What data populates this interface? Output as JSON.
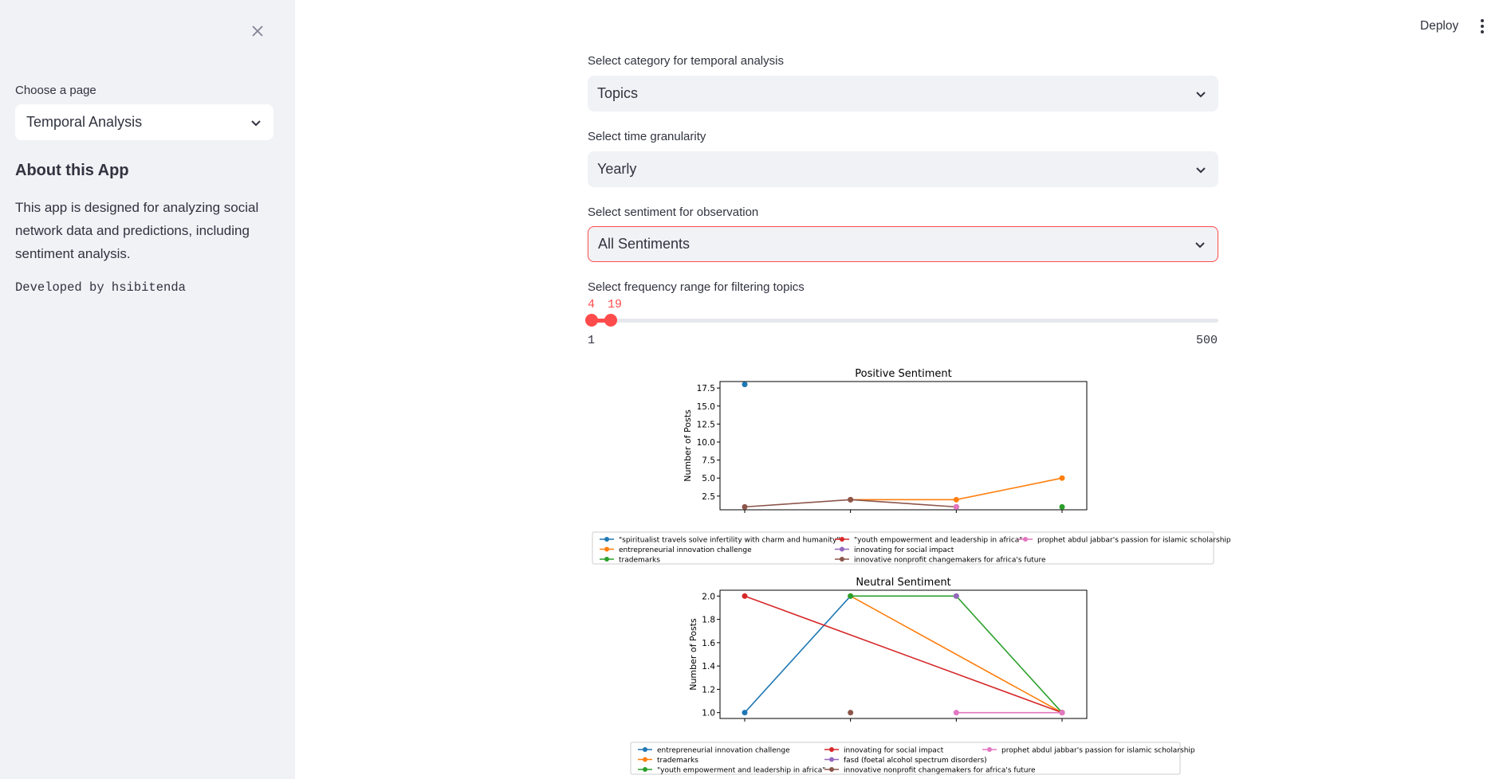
{
  "sidebar": {
    "page_select_label": "Choose a page",
    "page_select_value": "Temporal Analysis",
    "about_title": "About this App",
    "about_text": "This app is designed for analyzing social network data and predictions, including sentiment analysis.",
    "developer": "Developed by hsibitenda"
  },
  "header": {
    "deploy": "Deploy"
  },
  "controls": {
    "category": {
      "label": "Select category for temporal analysis",
      "value": "Topics"
    },
    "granularity": {
      "label": "Select time granularity",
      "value": "Yearly"
    },
    "sentiment": {
      "label": "Select sentiment for observation",
      "value": "All Sentiments"
    },
    "frequency": {
      "label": "Select frequency range for filtering topics",
      "low": 4,
      "high": 19,
      "min": 1,
      "max": 500
    }
  },
  "colors": {
    "accent": "#ff4b4b",
    "series": [
      "#1f77b4",
      "#ff7f0e",
      "#2ca02c",
      "#d62728",
      "#9467bd",
      "#8c564b",
      "#e377c2"
    ]
  },
  "chart_data": [
    {
      "type": "line",
      "title": "Positive Sentiment",
      "ylabel": "Number of Posts",
      "xlabel": "",
      "ylim": [
        0.6,
        18.4
      ],
      "yticks": [
        2.5,
        5.0,
        7.5,
        10.0,
        12.5,
        15.0,
        17.5
      ],
      "x_count": 4,
      "legend_columns": 3,
      "legend_placement": "below",
      "series": [
        {
          "name": "\"spiritualist travels solve infertility with charm and humanity\"",
          "color": "#1f77b4",
          "points": [
            [
              0,
              18
            ]
          ]
        },
        {
          "name": "entrepreneurial innovation challenge",
          "color": "#ff7f0e",
          "points": [
            [
              1,
              2
            ],
            [
              2,
              2
            ],
            [
              3,
              5
            ]
          ]
        },
        {
          "name": "trademarks",
          "color": "#2ca02c",
          "points": [
            [
              3,
              1
            ]
          ]
        },
        {
          "name": "\"youth empowerment and leadership in africa\"",
          "color": "#d62728",
          "points": [
            [
              1,
              2
            ]
          ]
        },
        {
          "name": "innovating for social impact",
          "color": "#9467bd",
          "points": [
            [
              2,
              1
            ]
          ]
        },
        {
          "name": "innovative nonprofit changemakers for africa's future",
          "color": "#8c564b",
          "points": [
            [
              0,
              1
            ],
            [
              1,
              2
            ],
            [
              2,
              1
            ]
          ]
        },
        {
          "name": "prophet abdul jabbar's passion for islamic scholarship",
          "color": "#e377c2",
          "points": [
            [
              2,
              1
            ]
          ]
        }
      ]
    },
    {
      "type": "line",
      "title": "Neutral Sentiment",
      "ylabel": "Number of Posts",
      "xlabel": "",
      "ylim": [
        0.95,
        2.05
      ],
      "yticks": [
        1.0,
        1.2,
        1.4,
        1.6,
        1.8,
        2.0
      ],
      "x_count": 4,
      "legend_columns": 3,
      "legend_placement": "below",
      "series": [
        {
          "name": "entrepreneurial innovation challenge",
          "color": "#1f77b4",
          "points": [
            [
              0,
              1
            ],
            [
              1,
              2
            ]
          ]
        },
        {
          "name": "trademarks",
          "color": "#ff7f0e",
          "points": [
            [
              1,
              2
            ],
            [
              3,
              1
            ]
          ]
        },
        {
          "name": "\"youth empowerment and leadership in africa\"",
          "color": "#2ca02c",
          "points": [
            [
              1,
              2
            ],
            [
              2,
              2
            ],
            [
              3,
              1
            ]
          ]
        },
        {
          "name": "innovating for social impact",
          "color": "#d62728",
          "points": [
            [
              0,
              2
            ],
            [
              3,
              1
            ]
          ]
        },
        {
          "name": "fasd (foetal alcohol spectrum disorders)",
          "color": "#9467bd",
          "points": [
            [
              2,
              2
            ]
          ]
        },
        {
          "name": "innovative nonprofit changemakers for africa's future",
          "color": "#8c564b",
          "points": [
            [
              1,
              1
            ]
          ]
        },
        {
          "name": "prophet abdul jabbar's passion for islamic scholarship",
          "color": "#e377c2",
          "points": [
            [
              2,
              1
            ],
            [
              3,
              1
            ]
          ]
        }
      ]
    }
  ]
}
